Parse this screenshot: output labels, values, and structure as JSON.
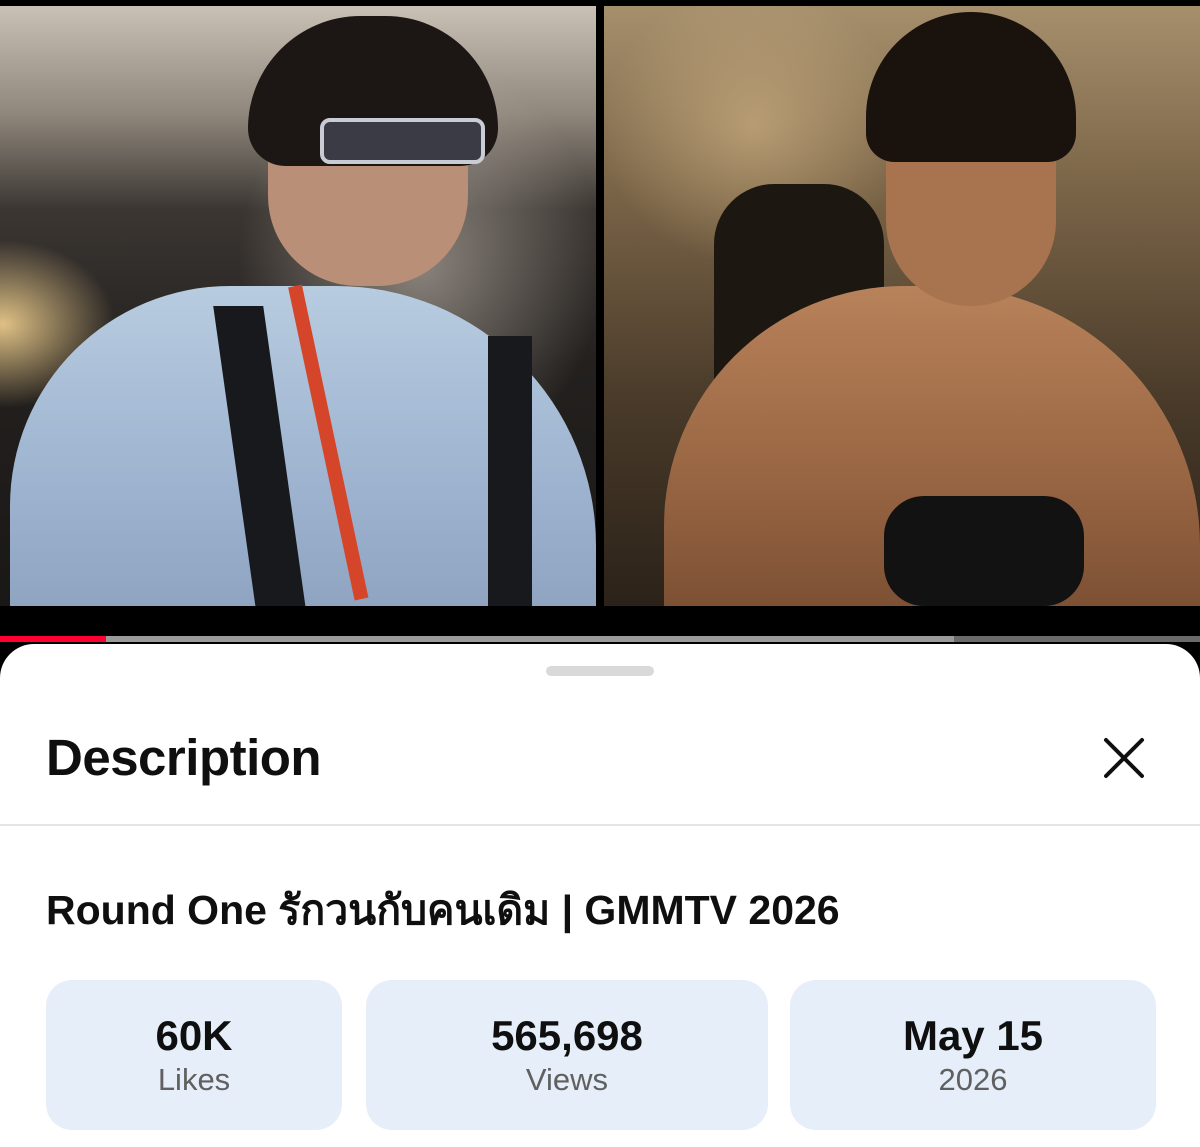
{
  "video": {
    "progress_fraction": 0.088,
    "buffer_fraction": 0.795
  },
  "colors": {
    "progress": "#ff0033",
    "stat_card_bg": "#e6eef9",
    "title_text": "#0f0f0f",
    "secondary_text": "#606060"
  },
  "sheet": {
    "title": "Description",
    "close_icon": "close-icon",
    "video_title": "Round One รักวนกับคนเดิม | GMMTV 2026",
    "stats": [
      {
        "value": "60K",
        "label": "Likes"
      },
      {
        "value": "565,698",
        "label": "Views"
      },
      {
        "value": "May 15",
        "label": "2026"
      }
    ]
  }
}
